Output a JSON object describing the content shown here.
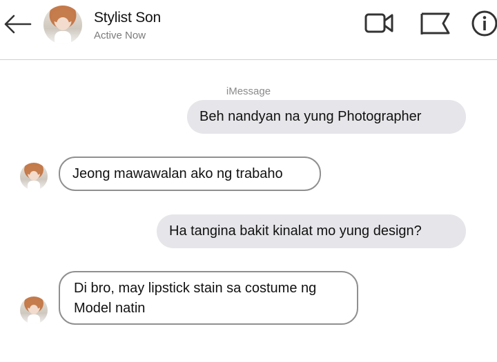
{
  "header": {
    "contact_name": "Stylist Son",
    "status": "Active Now"
  },
  "icons": [
    "back-arrow-icon",
    "video-camera-icon",
    "flag-icon",
    "info-icon"
  ],
  "conversation": {
    "service_label": "iMessage",
    "messages": [
      {
        "direction": "outgoing",
        "text": "Beh nandyan na yung Photographer"
      },
      {
        "direction": "incoming",
        "text": "Jeong mawawalan ako ng trabaho"
      },
      {
        "direction": "outgoing",
        "text": "Ha tangina bakit kinalat mo yung design?"
      },
      {
        "direction": "incoming",
        "text": "Di bro, may lipstick stain sa costume ng Model natin"
      }
    ]
  },
  "colors": {
    "outgoing_bubble": "#e6e6ea",
    "incoming_border": "#8f8f8f",
    "status_text": "#7a7a7a"
  }
}
